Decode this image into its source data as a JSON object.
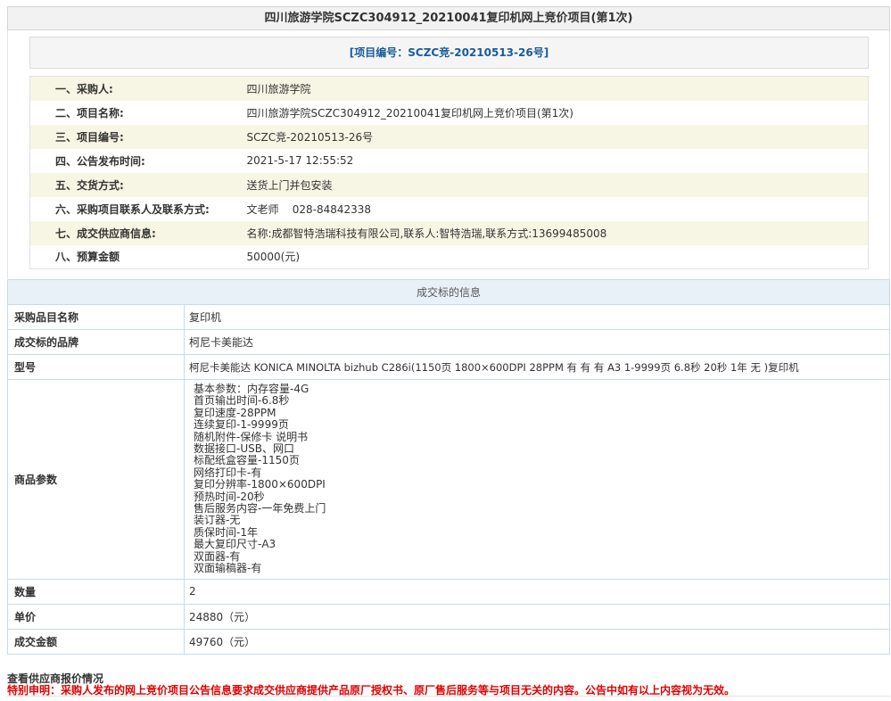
{
  "page": {
    "title": "四川旅游学院SCZC304912_20210041复印机网上竞价项目(第1次)",
    "project_code_banner": "[项目编号：SCZC竞-20210513-26号]"
  },
  "info": [
    {
      "label": "一、采购人:",
      "value": "四川旅游学院"
    },
    {
      "label": "二、项目名称:",
      "value": "四川旅游学院SCZC304912_20210041复印机网上竞价项目(第1次)"
    },
    {
      "label": "三、项目编号:",
      "value": "SCZC竞-20210513-26号"
    },
    {
      "label": "四、公告发布时间:",
      "value": "2021-5-17 12:55:52"
    },
    {
      "label": "五、交货方式:",
      "value": "送货上门并包安装"
    },
    {
      "label": "六、采购项目联系人及联系方式:",
      "value": "文老师    028-84842338"
    },
    {
      "label": "七、成交供应商信息:",
      "value": "名称:成都智特浩瑞科技有限公司,联系人:智特浩瑞,联系方式:13699485008"
    },
    {
      "label": "八、预算金额",
      "value": "50000(元)"
    }
  ],
  "deal": {
    "header": "成交标的信息",
    "item_name_label": "采购品目名称",
    "item_name": "复印机",
    "brand_label": "成交标的品牌",
    "brand": "柯尼卡美能达",
    "model_label": "型号",
    "model": "柯尼卡美能达 KONICA MINOLTA bizhub C286i(1150页 1800×600DPI 28PPM 有 有 有 A3 1-9999页 6.8秒 20秒 1年 无 )复印机",
    "params_label": "商品参数",
    "params": [
      "基本参数：内存容量-4G",
      "首页输出时间-6.8秒",
      "复印速度-28PPM",
      "连续复印-1-9999页",
      "随机附件-保修卡 说明书",
      "数据接口-USB、网口",
      "标配纸盒容量-1150页",
      "网络打印卡-有",
      "复印分辨率-1800×600DPI",
      "预热时间-20秒",
      "售后服务内容-一年免费上门",
      "装订器-无",
      "质保时间-1年",
      "最大复印尺寸-A3",
      "双面器-有",
      "双面输稿器-有"
    ],
    "qty_label": "数量",
    "qty": "2",
    "unit_price_label": "单价",
    "unit_price": "24880（元）",
    "total_label": "成交金额",
    "total": "49760（元）"
  },
  "footer": {
    "title": "查看供应商报价情况",
    "note": "特别申明：采购人发布的网上竞价项目公告信息要求成交供应商提供产品原厂授权书、原厂售后服务等与项目无关的内容。公告中如有以上内容视为无效。"
  }
}
